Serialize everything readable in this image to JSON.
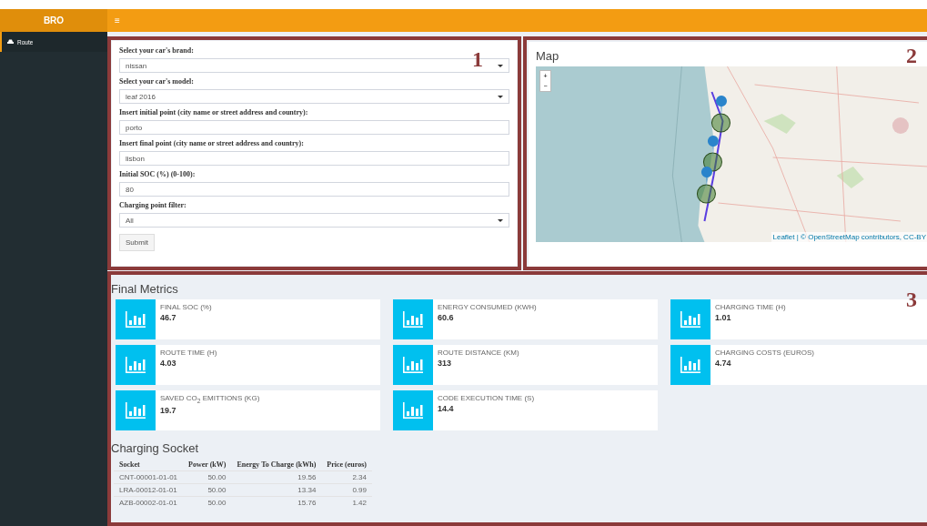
{
  "header": {
    "logo": "BRO",
    "menu_icon": "≡"
  },
  "sidebar": {
    "items": [
      {
        "label": "Route",
        "selected": true
      }
    ]
  },
  "form_panel": {
    "annotation": "1",
    "fields": [
      {
        "kind": "select",
        "label": "Select your car's brand:",
        "value": "nissan"
      },
      {
        "kind": "select",
        "label": "Select your car's model:",
        "value": "leaf 2016"
      },
      {
        "kind": "text",
        "label": "Insert initial point (city name or street address and country):",
        "value": "porto"
      },
      {
        "kind": "text",
        "label": "Insert final point (city name or street address and country):",
        "value": "lisbon"
      },
      {
        "kind": "text",
        "label": "Initial SOC (%) (0-100):",
        "value": "80"
      },
      {
        "kind": "select",
        "label": "Charging point filter:",
        "value": "All"
      }
    ],
    "submit": "Submit"
  },
  "map_panel": {
    "annotation": "2",
    "title": "Map",
    "zoom_in": "+",
    "zoom_out": "−",
    "attribution": "Leaflet | © OpenStreetMap contributors, CC-BY"
  },
  "results": {
    "annotation": "3",
    "metrics_title": "Final Metrics",
    "metrics": [
      {
        "label": "FINAL SOC (%)",
        "value": "46.7"
      },
      {
        "label": "ENERGY CONSUMED (KWH)",
        "value": "60.6"
      },
      {
        "label": "CHARGING TIME (H)",
        "value": "1.01"
      },
      {
        "label": "ROUTE TIME (H)",
        "value": "4.03"
      },
      {
        "label": "ROUTE DISTANCE (KM)",
        "value": "313"
      },
      {
        "label": "CHARGING COSTS (EUROS)",
        "value": "4.74"
      },
      {
        "label": "SAVED CO$_{2}$ EMITTIONS (KG)",
        "value": "19.7"
      },
      {
        "label": "CODE EXECUTION TIME (S)",
        "value": "14.4"
      }
    ],
    "table_title": "Charging Socket",
    "table": {
      "columns": [
        "Socket",
        "Power (kW)",
        "Energy To Charge (kWh)",
        "Price (euros)"
      ],
      "rows": [
        [
          "CNT-00001-01-01",
          "50.00",
          "19.56",
          "2.34"
        ],
        [
          "LRA-00012-01-01",
          "50.00",
          "13.34",
          "0.99"
        ],
        [
          "AZB-00002-01-01",
          "50.00",
          "15.76",
          "1.42"
        ]
      ]
    }
  }
}
